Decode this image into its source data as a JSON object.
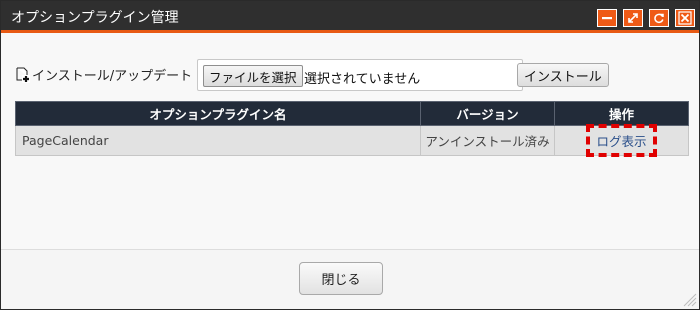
{
  "dialog": {
    "title": "オプションプラグイン管理",
    "window_buttons": [
      {
        "icon": "minimize-icon"
      },
      {
        "icon": "maximize-icon"
      },
      {
        "icon": "refresh-icon"
      },
      {
        "icon": "close-icon"
      }
    ],
    "accent_color": "#e85a14"
  },
  "install": {
    "label": "インストール/アップデート",
    "label_icon": "add-file-icon",
    "file_button": "ファイルを選択",
    "file_status": "選択されていません",
    "install_button": "インストール"
  },
  "table": {
    "headers": [
      "オプションプラグイン名",
      "バージョン",
      "操作"
    ],
    "rows": [
      {
        "name": "PageCalendar",
        "version": "アンインストール済み",
        "action": "ログ表示"
      }
    ]
  },
  "footer": {
    "close_button": "閉じる"
  }
}
